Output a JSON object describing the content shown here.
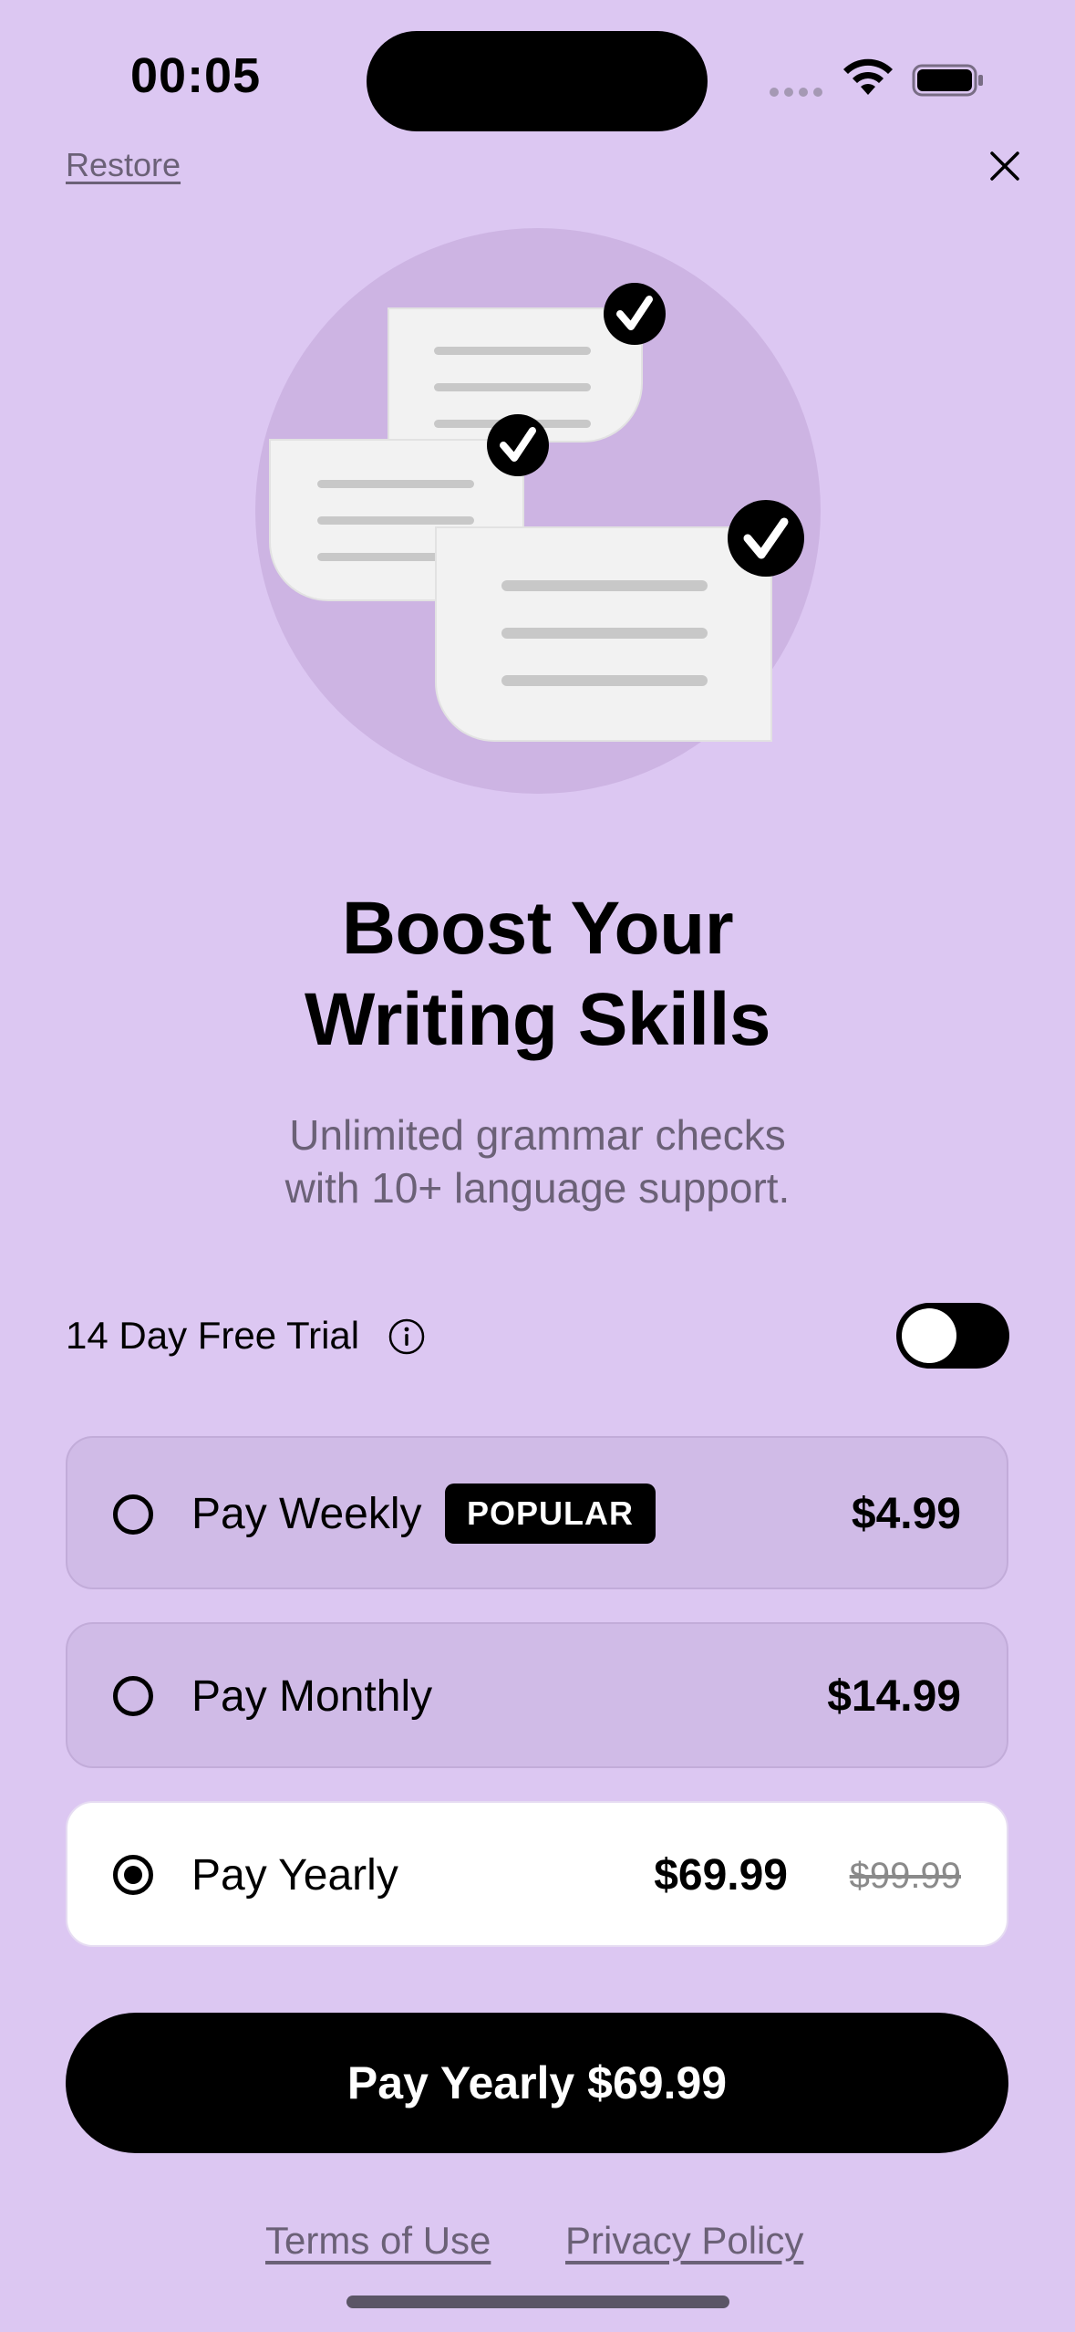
{
  "status_bar": {
    "time": "00:05"
  },
  "header": {
    "restore_label": "Restore",
    "close_icon": "close-icon"
  },
  "hero": {
    "title_line1": "Boost Your",
    "title_line2": "Writing Skills",
    "subtitle_line1": "Unlimited grammar checks",
    "subtitle_line2": "with 10+ language support."
  },
  "trial": {
    "label": "14 Day Free Trial",
    "info_icon": "info-icon",
    "enabled": false
  },
  "plans": [
    {
      "name": "Pay Weekly",
      "badge": "POPULAR",
      "price": "$4.99",
      "selected": false
    },
    {
      "name": "Pay Monthly",
      "price": "$14.99",
      "selected": false
    },
    {
      "name": "Pay Yearly",
      "price": "$69.99",
      "original_price": "$99.99",
      "selected": true
    }
  ],
  "cta": {
    "label": "Pay Yearly $69.99"
  },
  "footer": {
    "terms_label": "Terms of Use",
    "privacy_label": "Privacy Policy"
  },
  "colors": {
    "background": "#dcc7f2",
    "plan_unselected": "#d0bbe7",
    "plan_selected": "#ffffff",
    "accent": "#000000",
    "muted_text": "#6b6177"
  }
}
